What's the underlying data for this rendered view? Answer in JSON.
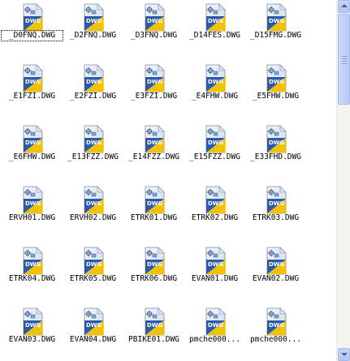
{
  "files": [
    {
      "name": "_D0FNQ.DWG",
      "icon": "dwg-file-icon"
    },
    {
      "name": "_D2FNQ.DWG",
      "icon": "dwg-file-icon"
    },
    {
      "name": "_D3FNQ.DWG",
      "icon": "dwg-file-icon"
    },
    {
      "name": "_D14FES.DWG",
      "icon": "dwg-file-icon"
    },
    {
      "name": "_D15FMG.DWG",
      "icon": "dwg-file-icon"
    },
    {
      "name": "_E1FZI.DWG",
      "icon": "dwg-file-icon"
    },
    {
      "name": "_E2FZI.DWG",
      "icon": "dwg-file-icon"
    },
    {
      "name": "_E3FZI.DWG",
      "icon": "dwg-file-icon"
    },
    {
      "name": "_E4FHW.DWG",
      "icon": "dwg-file-icon"
    },
    {
      "name": "_E5FHW.DWG",
      "icon": "dwg-file-icon"
    },
    {
      "name": "_E6FHW.DWG",
      "icon": "dwg-file-icon"
    },
    {
      "name": "_E13FZZ.DWG",
      "icon": "dwg-file-icon"
    },
    {
      "name": "_E14FZZ.DWG",
      "icon": "dwg-file-icon"
    },
    {
      "name": "_E15FZZ.DWG",
      "icon": "dwg-file-icon"
    },
    {
      "name": "_E33FHD.DWG",
      "icon": "dwg-file-icon"
    },
    {
      "name": "ERVH01.DWG",
      "icon": "dwg-file-icon"
    },
    {
      "name": "ERVH02.DWG",
      "icon": "dwg-file-icon"
    },
    {
      "name": "ETRK01.DWG",
      "icon": "dwg-file-icon"
    },
    {
      "name": "ETRK02.DWG",
      "icon": "dwg-file-icon"
    },
    {
      "name": "ETRK03.DWG",
      "icon": "dwg-file-icon"
    },
    {
      "name": "ETRK04.DWG",
      "icon": "dwg-file-icon"
    },
    {
      "name": "ETRK05.DWG",
      "icon": "dwg-file-icon"
    },
    {
      "name": "ETRK06.DWG",
      "icon": "dwg-file-icon"
    },
    {
      "name": "EVAN01.DWG",
      "icon": "dwg-file-icon"
    },
    {
      "name": "EVAN02.DWG",
      "icon": "dwg-file-icon"
    },
    {
      "name": "EVAN03.DWG",
      "icon": "dwg-file-icon"
    },
    {
      "name": "EVAN04.DWG",
      "icon": "dwg-file-icon"
    },
    {
      "name": "PBIKE01.DWG",
      "icon": "dwg-file-icon"
    },
    {
      "name": "pmche000...",
      "icon": "dwg-file-icon"
    },
    {
      "name": "pmche000...",
      "icon": "dwg-file-icon"
    }
  ],
  "icon_badge_text": "DWG",
  "colors": {
    "icon_blue": "#2c5aa8",
    "icon_yellow": "#f2c200",
    "background": "#ffffff",
    "scrollbar": "#c1d1f7"
  }
}
